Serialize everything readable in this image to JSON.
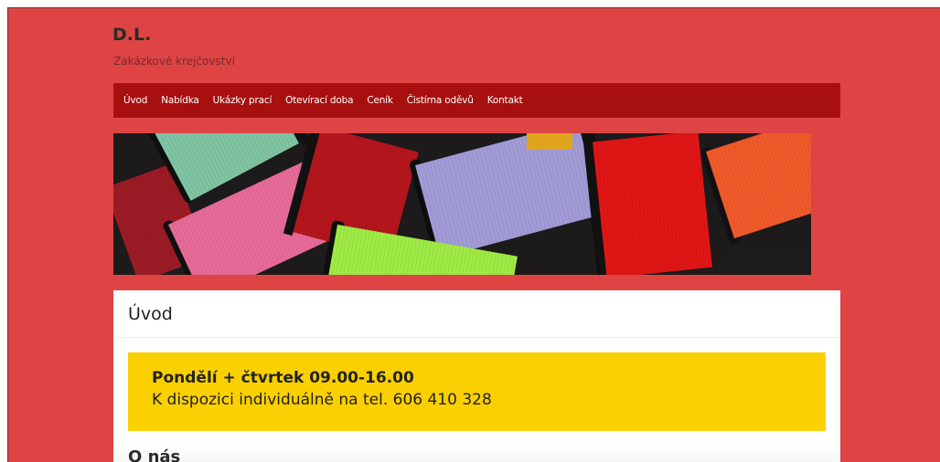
{
  "site": {
    "title": "D.L.",
    "description": "Zakázkové krejčovství"
  },
  "nav": {
    "items": [
      {
        "label": "Úvod",
        "name": "nav-item-uvod"
      },
      {
        "label": "Nabídka",
        "name": "nav-item-nabidka"
      },
      {
        "label": "Ukázky prací",
        "name": "nav-item-ukazky-praci"
      },
      {
        "label": "Otevírací doba",
        "name": "nav-item-oteviraci-doba"
      },
      {
        "label": "Ceník",
        "name": "nav-item-cenik"
      },
      {
        "label": "Čistírna oděvů",
        "name": "nav-item-cistirna-odevu"
      },
      {
        "label": "Kontakt",
        "name": "nav-item-kontakt"
      }
    ]
  },
  "banner": {
    "icon": "thread-spools-image"
  },
  "main": {
    "page_title": "Úvod",
    "notice": {
      "line1": "Pondělí + čtvrtek 09.00-16.00",
      "line2": "K dispozici individuálně na tel. 606 410 328"
    },
    "section_heading": "O nás"
  },
  "colors": {
    "background": "#de4444",
    "nav": "#a80f0f",
    "notice": "#fbd000",
    "content": "#ffffff"
  }
}
